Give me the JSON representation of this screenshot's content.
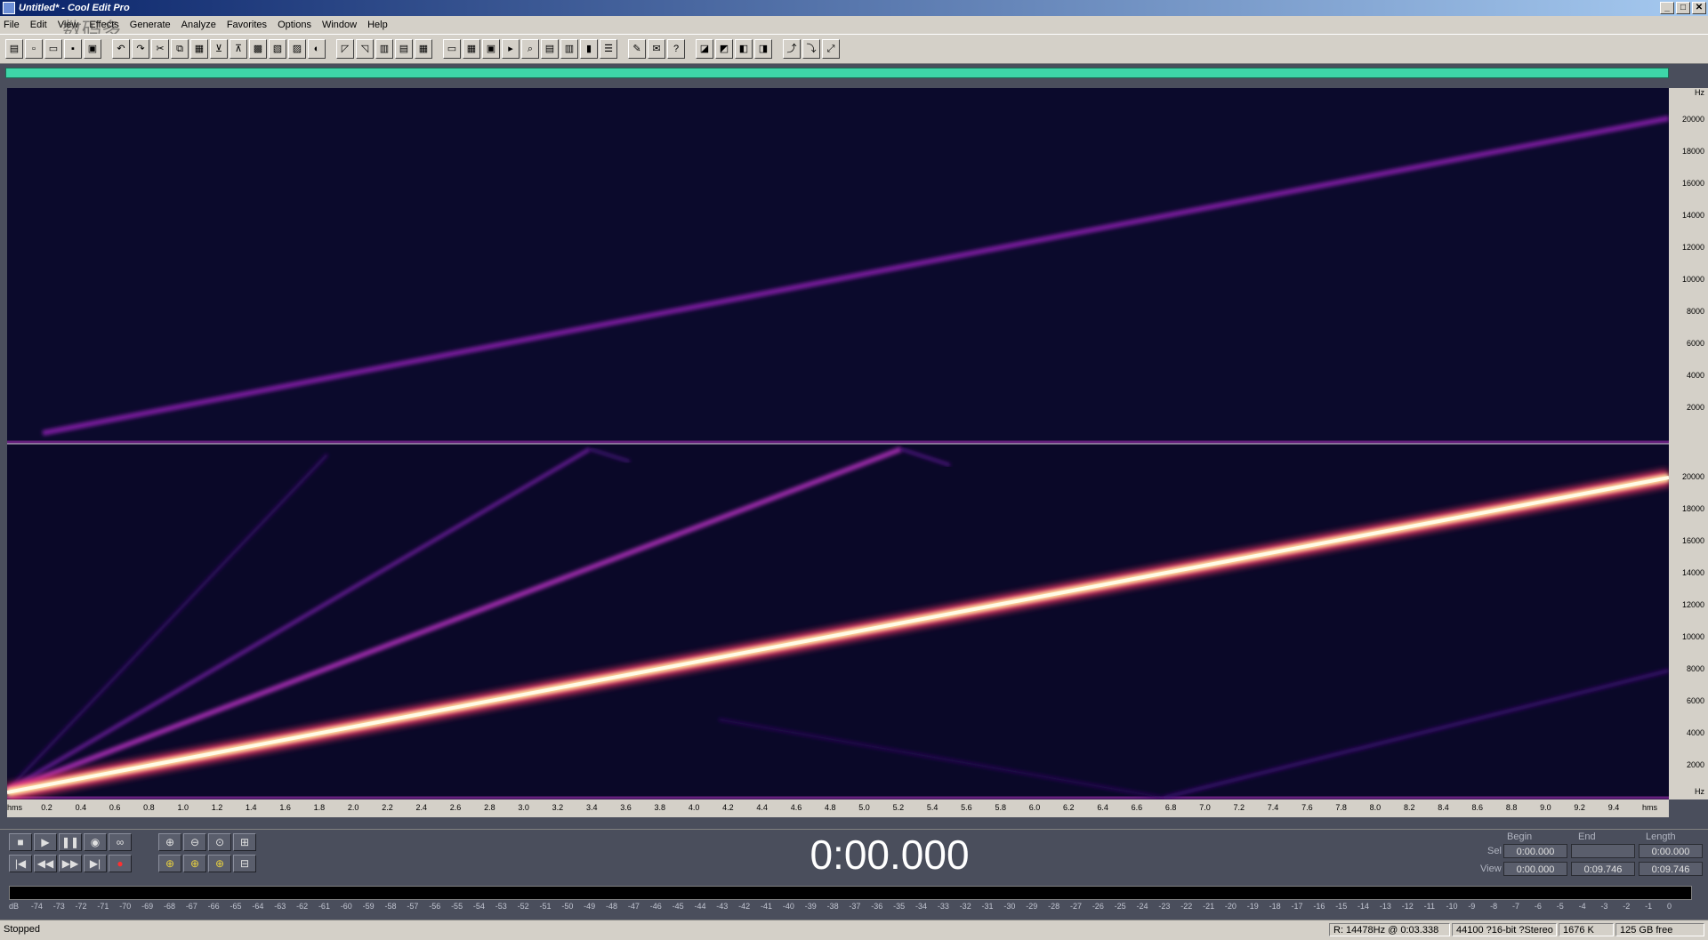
{
  "window": {
    "title": "Untitled* - Cool Edit Pro",
    "controls": [
      "_",
      "□",
      "✕"
    ]
  },
  "menu": [
    "File",
    "Edit",
    "View",
    "Effects",
    "Generate",
    "Analyze",
    "Favorites",
    "Options",
    "Window",
    "Help"
  ],
  "watermark": "数码多",
  "spectrogram": {
    "hz_ticks_top": [
      "Hz",
      "20000",
      "18000",
      "16000",
      "14000",
      "12000",
      "10000",
      "8000",
      "6000",
      "4000",
      "2000"
    ],
    "hz_ticks_bottom": [
      "20000",
      "18000",
      "16000",
      "14000",
      "12000",
      "10000",
      "8000",
      "6000",
      "4000",
      "2000",
      "Hz"
    ],
    "time_ticks": [
      "hms",
      "0.2",
      "0.4",
      "0.6",
      "0.8",
      "1.0",
      "1.2",
      "1.4",
      "1.6",
      "1.8",
      "2.0",
      "2.2",
      "2.4",
      "2.6",
      "2.8",
      "3.0",
      "3.2",
      "3.4",
      "3.6",
      "3.8",
      "4.0",
      "4.2",
      "4.4",
      "4.6",
      "4.8",
      "5.0",
      "5.2",
      "5.4",
      "5.6",
      "5.8",
      "6.0",
      "6.2",
      "6.4",
      "6.6",
      "6.8",
      "7.0",
      "7.2",
      "7.4",
      "7.6",
      "7.8",
      "8.0",
      "8.2",
      "8.4",
      "8.6",
      "8.8",
      "9.0",
      "9.2",
      "9.4",
      "hms"
    ],
    "colors": {
      "background": "#0a0828",
      "dim": "#6a1a8a",
      "mid": "#b02aa8",
      "hot": "#fff8d0"
    }
  },
  "transport": {
    "time": "0:00.000",
    "buttons_row1": [
      "■",
      "▶",
      "❚❚",
      "◉",
      "∞"
    ],
    "buttons_row2": [
      "|◀",
      "◀◀",
      "▶▶",
      "▶|",
      "●"
    ],
    "zoom_row1": [
      "⊕",
      "⊖",
      "⊙",
      "⊞"
    ],
    "zoom_row2": [
      "⊕",
      "⊕",
      "⊕",
      "⊟"
    ]
  },
  "selection": {
    "headers": [
      "Begin",
      "End",
      "Length"
    ],
    "sel_label": "Sel",
    "view_label": "View",
    "sel": [
      "0:00.000",
      "",
      "0:00.000"
    ],
    "view": [
      "0:00.000",
      "0:09.746",
      "0:09.746"
    ]
  },
  "meter_scale": [
    "dB",
    "-74",
    "-73",
    "-72",
    "-71",
    "-70",
    "-69",
    "-68",
    "-67",
    "-66",
    "-65",
    "-64",
    "-63",
    "-62",
    "-61",
    "-60",
    "-59",
    "-58",
    "-57",
    "-56",
    "-55",
    "-54",
    "-53",
    "-52",
    "-51",
    "-50",
    "-49",
    "-48",
    "-47",
    "-46",
    "-45",
    "-44",
    "-43",
    "-42",
    "-41",
    "-40",
    "-39",
    "-38",
    "-37",
    "-36",
    "-35",
    "-34",
    "-33",
    "-32",
    "-31",
    "-30",
    "-29",
    "-28",
    "-27",
    "-26",
    "-25",
    "-24",
    "-23",
    "-22",
    "-21",
    "-20",
    "-19",
    "-18",
    "-17",
    "-16",
    "-15",
    "-14",
    "-13",
    "-12",
    "-11",
    "-10",
    "-9",
    "-8",
    "-7",
    "-6",
    "-5",
    "-4",
    "-3",
    "-2",
    "-1",
    "0"
  ],
  "status": {
    "state": "Stopped",
    "cursor": "R: 14478Hz @  0:03.338",
    "format": "44100 ?16-bit ?Stereo",
    "size": "1676 K",
    "free": "125 GB free"
  }
}
